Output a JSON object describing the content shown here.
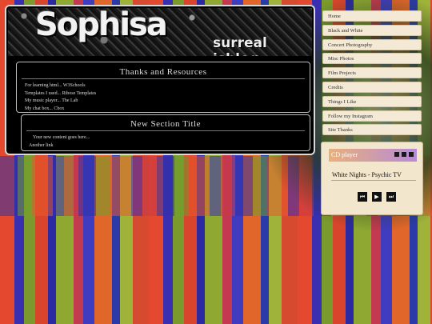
{
  "site": {
    "logo_text": "Sophisa",
    "tagline": "surreal isblog"
  },
  "nav": [
    "Home",
    "Black and White",
    "Concert Photography",
    "Misc Photos",
    "Film Projects",
    "Credits",
    "Things I Like",
    "Follow my Instagram",
    "Site Thanks"
  ],
  "box1": {
    "title": "Thanks and Resources",
    "lines": [
      "For learning html... W3Schools",
      "Templates I used... Ribose Templates",
      "My music player... The Lab",
      "My chat box... Cbox"
    ]
  },
  "box2": {
    "title": "New Section Title",
    "lines": [
      "Your new content goes here...",
      "Another link"
    ]
  },
  "player": {
    "title": "CD player",
    "track": "White Nights - Psychic TV",
    "icons": {
      "prev": "⏮",
      "play": "▶",
      "next": "⏭"
    }
  },
  "colors": {
    "panel": "#000000",
    "nav_bg": "#f3e9d4",
    "player_bg": "#f2e6cc"
  }
}
